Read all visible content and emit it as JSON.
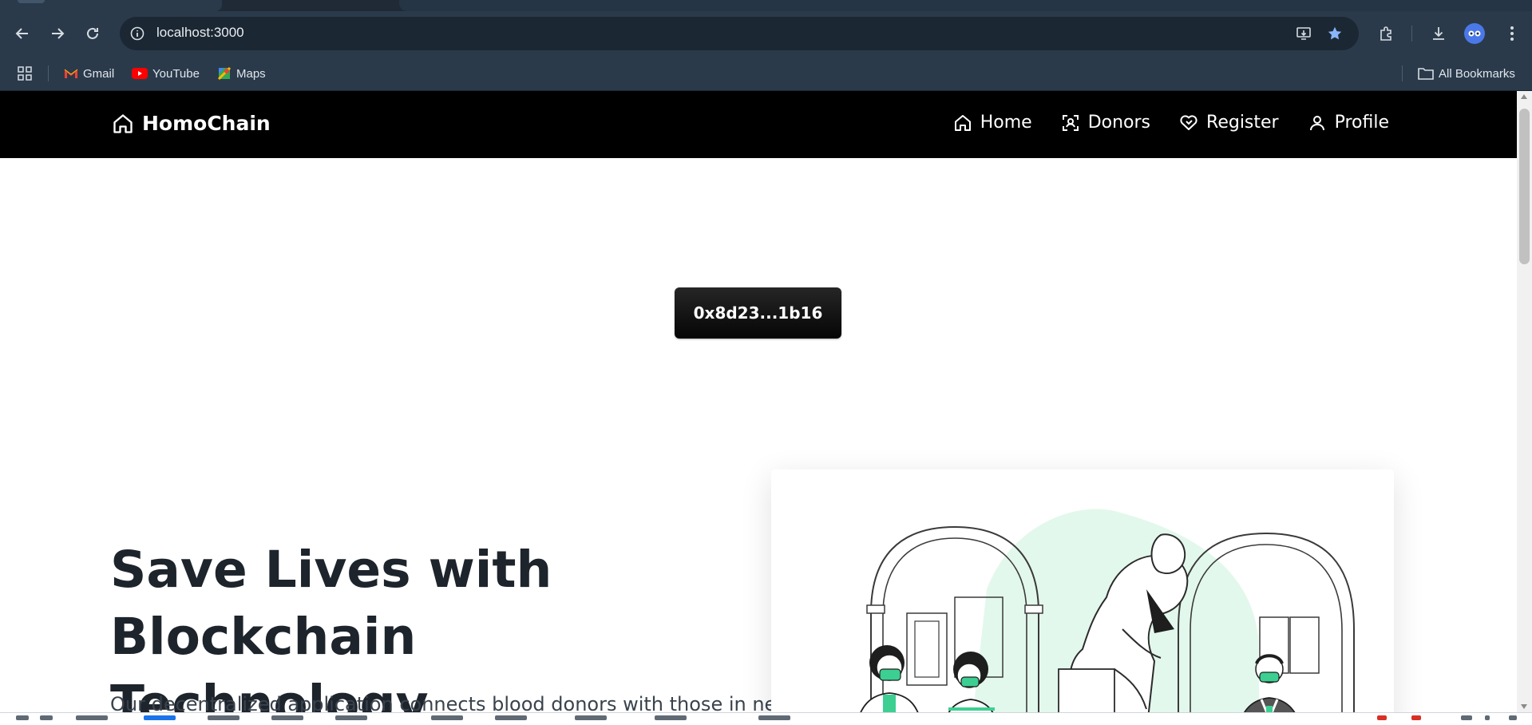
{
  "browser": {
    "url": "localhost:3000",
    "bookmarks": [
      {
        "label": "Gmail",
        "icon": "gmail-icon"
      },
      {
        "label": "YouTube",
        "icon": "youtube-icon"
      },
      {
        "label": "Maps",
        "icon": "maps-icon"
      }
    ],
    "all_bookmarks_label": "All Bookmarks"
  },
  "app": {
    "brand": "HomoChain",
    "nav": [
      {
        "label": "Home",
        "icon": "home-icon"
      },
      {
        "label": "Donors",
        "icon": "scan-icon"
      },
      {
        "label": "Register",
        "icon": "heart-handshake-icon"
      },
      {
        "label": "Profile",
        "icon": "user-icon"
      }
    ],
    "wallet_address": "0x8d23...1b16",
    "hero_title_line1": "Save Lives with",
    "hero_title_line2": "Blockchain Technology",
    "hero_subtitle": "Our decentralized application connects blood donors with those in need."
  },
  "colors": {
    "navbar_bg": "#000000",
    "accent_green": "#3ccf91",
    "illus_blob": "#e3f8ec",
    "text_dark": "#1d242c"
  }
}
